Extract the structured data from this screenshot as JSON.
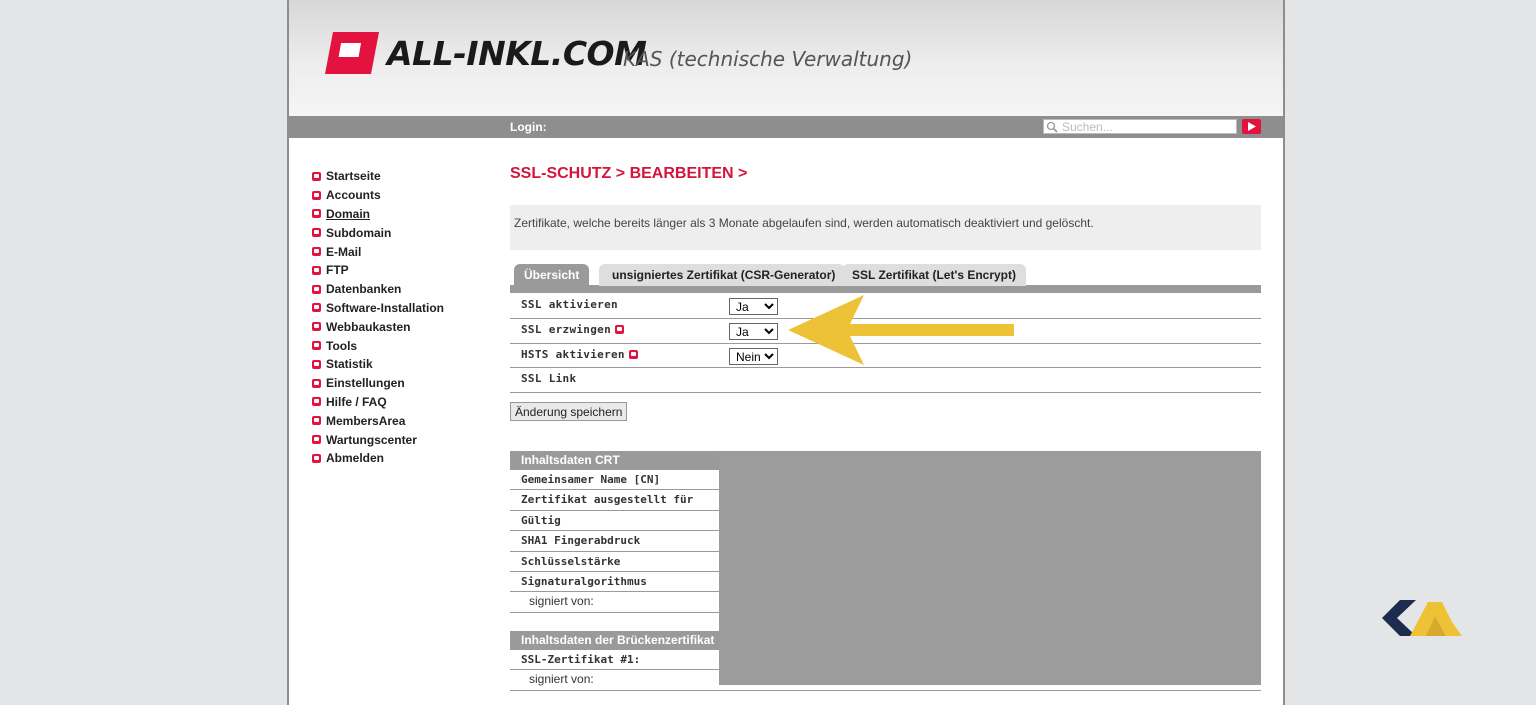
{
  "header": {
    "brand": "ALL-INKL.COM",
    "subtitle": "KAS (technische Verwaltung)"
  },
  "topbar": {
    "login_label": "Login:",
    "search_placeholder": "Suchen..."
  },
  "sidebar": {
    "items": [
      {
        "label": "Startseite"
      },
      {
        "label": "Accounts"
      },
      {
        "label": "Domain"
      },
      {
        "label": "Subdomain"
      },
      {
        "label": "E-Mail"
      },
      {
        "label": "FTP"
      },
      {
        "label": "Datenbanken"
      },
      {
        "label": "Software-Installation"
      },
      {
        "label": "Webbaukasten"
      },
      {
        "label": "Tools"
      },
      {
        "label": "Statistik"
      },
      {
        "label": "Einstellungen"
      },
      {
        "label": "Hilfe / FAQ"
      },
      {
        "label": "MembersArea"
      },
      {
        "label": "Wartungscenter"
      },
      {
        "label": "Abmelden"
      }
    ],
    "active": "Domain"
  },
  "main": {
    "title": "SSL-SCHUTZ > BEARBEITEN >",
    "info": "Zertifikate, welche bereits länger als 3 Monate abgelaufen sind, werden automatisch deaktiviert und gelöscht.",
    "tabs": [
      {
        "label": "Übersicht"
      },
      {
        "label": "unsigniertes Zertifikat (CSR-Generator)"
      },
      {
        "label": "SSL Zertifikat (Let's Encrypt)"
      }
    ],
    "settings": [
      {
        "label": "SSL aktivieren",
        "value": "Ja"
      },
      {
        "label": "SSL erzwingen",
        "value": "Ja"
      },
      {
        "label": "HSTS aktivieren",
        "value": "Nein"
      },
      {
        "label": "SSL Link"
      }
    ],
    "select_options": [
      "Ja",
      "Nein"
    ],
    "save_label": "Änderung speichern",
    "crt": {
      "header": "Inhaltsdaten CRT",
      "rows": [
        "Gemeinsamer Name [CN]",
        "Zertifikat ausgestellt für",
        "Gültig",
        "SHA1 Fingerabdruck",
        "Schlüsselstärke",
        "Signaturalgorithmus",
        "signiert von:"
      ]
    },
    "bridge": {
      "header": "Inhaltsdaten der Brückenzertifikat",
      "rows": [
        "SSL-Zertifikat #1:",
        "signiert von:"
      ]
    }
  },
  "colors": {
    "accent": "#e4123e",
    "title_red": "#d4143b",
    "bar_gray": "#8e8e8e",
    "arrow_yellow": "#eec237",
    "corner_logo_navy": "#1d2b4f"
  }
}
